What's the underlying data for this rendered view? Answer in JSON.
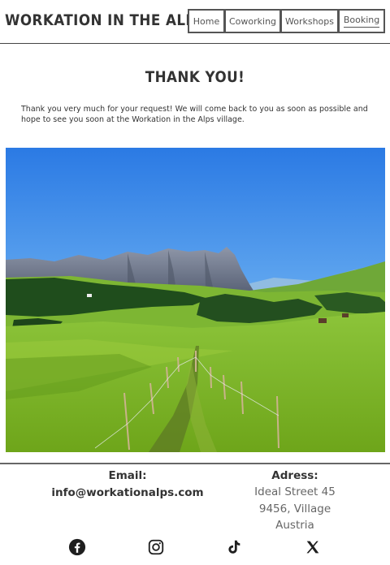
{
  "header": {
    "logo": "WORKATION IN THE ALPS",
    "nav": [
      {
        "label": "Home"
      },
      {
        "label": "Coworking"
      },
      {
        "label": "Workshops"
      },
      {
        "label": "Booking"
      }
    ]
  },
  "main": {
    "title": "THANK YOU!",
    "message": "Thank you very much for your request! We will come back to you as soon as possible and hope to see you soon at the Workation in the Alps village."
  },
  "footer": {
    "email_heading": "Email:",
    "email": "info@workationalps.com",
    "address_heading": "Adress:",
    "address_lines": [
      "Ideal Street 45",
      "9456, Village",
      "Austria"
    ],
    "socials": [
      "facebook-icon",
      "instagram-icon",
      "tiktok-icon",
      "x-icon"
    ]
  },
  "colors": {
    "text": "#333333",
    "muted": "#666666",
    "sky_top": "#2f7fe6",
    "sky_bottom": "#9fd0f5",
    "grass": "#7fb51f"
  }
}
